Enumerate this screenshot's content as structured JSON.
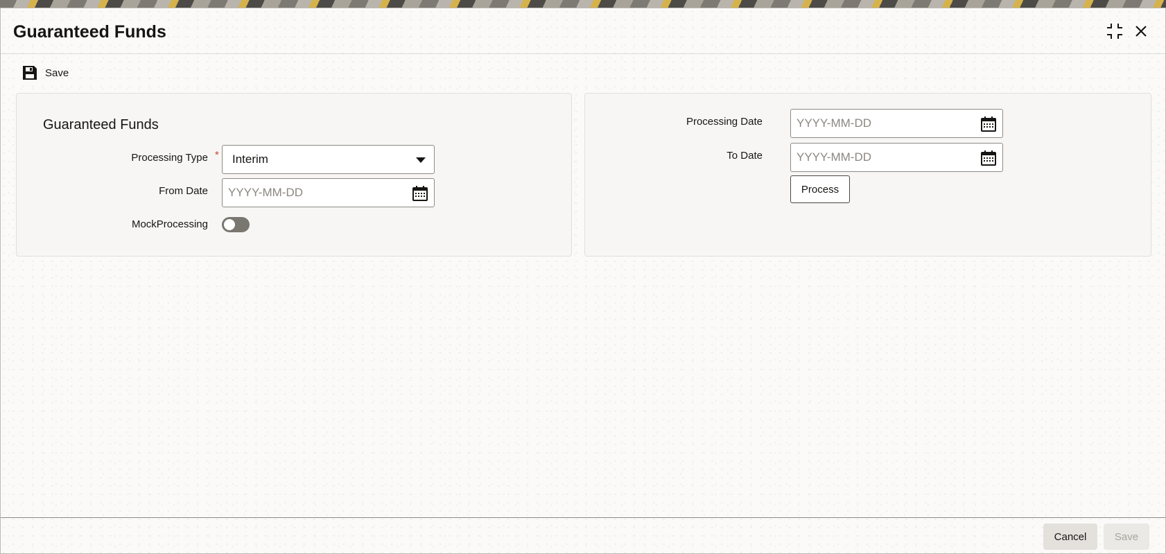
{
  "window": {
    "title": "Guaranteed Funds"
  },
  "toolbar": {
    "save_label": "Save"
  },
  "left_panel": {
    "section_title": "Guaranteed Funds",
    "processing_type": {
      "label": "Processing Type",
      "required_mark": "*",
      "value": "Interim"
    },
    "from_date": {
      "label": "From Date",
      "placeholder": "YYYY-MM-DD"
    },
    "mock_processing": {
      "label": "MockProcessing",
      "on": false
    }
  },
  "right_panel": {
    "processing_date": {
      "label": "Processing Date",
      "placeholder": "YYYY-MM-DD"
    },
    "to_date": {
      "label": "To Date",
      "placeholder": "YYYY-MM-DD"
    },
    "process_button": "Process"
  },
  "footer": {
    "cancel_label": "Cancel",
    "save_label": "Save"
  },
  "icons": {
    "maximize": "maximize-icon",
    "close": "close-icon",
    "save": "floppy-disk-icon",
    "calendar": "calendar-icon",
    "dropdown": "chevron-down-icon"
  }
}
